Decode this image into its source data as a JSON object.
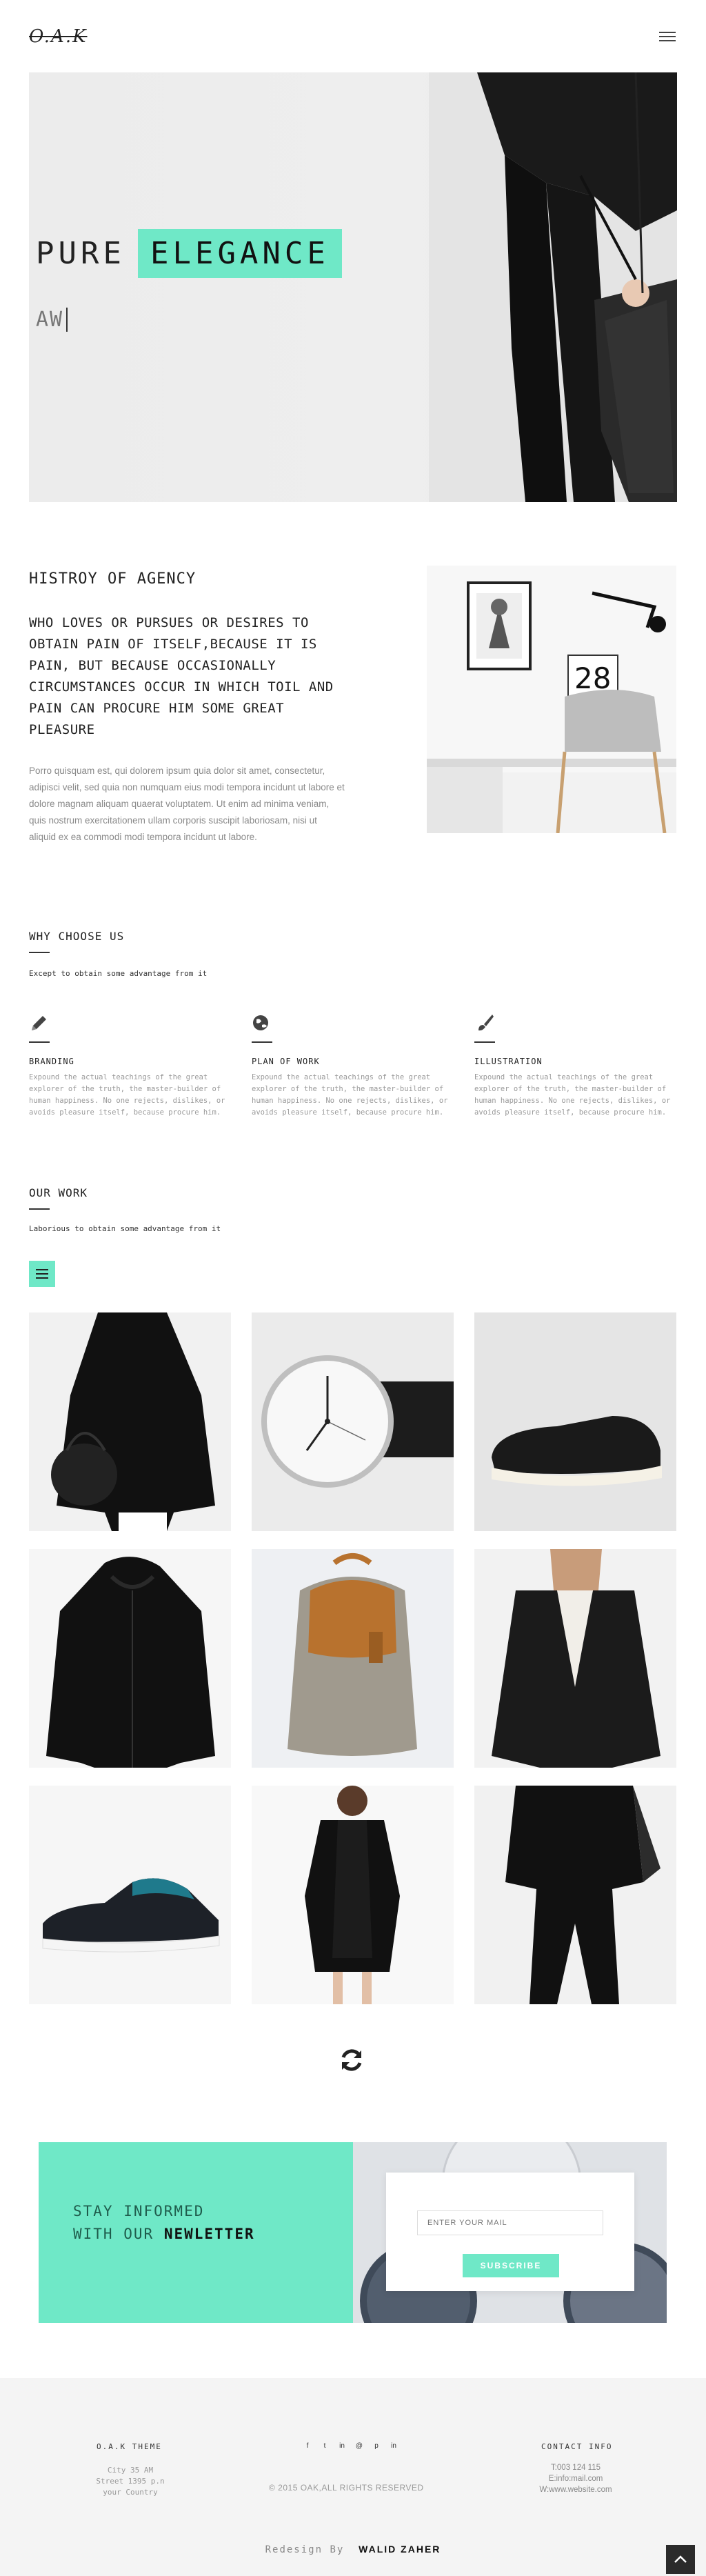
{
  "header": {
    "logo": "O.A.K",
    "menu_icon": "hamburger-menu-icon"
  },
  "hero": {
    "title_word1": "PURE",
    "title_word2": "ELEGANCE",
    "typed_text": "AW"
  },
  "history": {
    "title": "HISTROY OF AGENCY",
    "lead": "WHO LOVES OR PURSUES OR DESIRES TO OBTAIN PAIN OF ITSELF,BECAUSE IT IS PAIN, BUT BECAUSE OCCASIONALLY CIRCUMSTANCES OCCUR IN WHICH TOIL AND PAIN CAN PROCURE HIM SOME GREAT PLEASURE",
    "body": "Porro quisquam est, qui dolorem ipsum quia dolor sit amet, consectetur, adipisci velit, sed quia non numquam eius modi tempora incidunt ut labore et dolore magnam aliquam quaerat voluptatem. Ut enim ad minima veniam, quis nostrum exercitationem ullam corporis suscipit laboriosam, nisi ut aliquid ex ea commodi modi tempora incidunt ut labore.",
    "calendar_number": "28"
  },
  "why": {
    "title": "WHY CHOOSE US",
    "subtitle": "Except to obtain some advantage from it",
    "features": [
      {
        "icon": "pencil-icon",
        "title": "BRANDING",
        "text": "Expound the actual teachings of the great explorer of the truth, the master-builder of human happiness. No one rejects, dislikes, or avoids pleasure itself, because procure him."
      },
      {
        "icon": "globe-icon",
        "title": "PLAN OF WORK",
        "text": "Expound the actual teachings of the great explorer of the truth, the master-builder of human happiness. No one rejects, dislikes, or avoids pleasure itself, because procure him."
      },
      {
        "icon": "paintbrush-icon",
        "title": "ILLUSTRATION",
        "text": "Expound the actual teachings of the great explorer of the truth, the master-builder of human happiness. No one rejects, dislikes, or avoids pleasure itself, because procure him."
      }
    ]
  },
  "work": {
    "title": "OUR WORK",
    "subtitle": "Laborious to obtain some advantage from it",
    "filter_icon": "filter-menu-icon",
    "refresh_icon": "refresh-icon"
  },
  "newsletter": {
    "line1": "STAY INFORMED",
    "line2_prefix": "WITH OUR",
    "line2_bold": "NEWLETTER",
    "input_placeholder": "ENTER YOUR MAIL",
    "button": "SUBSCRIBE"
  },
  "footer": {
    "theme_title": "O.A.K THEME",
    "address_line1": "City 35 AM",
    "address_line2": "Street 1395 p.n",
    "address_line3": "your Country",
    "social": [
      "f",
      "t",
      "in",
      "@",
      "p",
      "in"
    ],
    "copyright": "© 2015 OAK,ALL RIGHTS RESERVED",
    "contact_title": "CONTACT INFO",
    "phone": "T:003 124 115",
    "email": "E:info:mail.com",
    "website": "W:www.website.com",
    "credit_prefix": "Redesign By",
    "credit_name": "WALID ZAHER"
  },
  "colors": {
    "accent": "#6fe8c7",
    "dark": "#222222",
    "muted": "#999999",
    "footer_bg": "#f4f4f4"
  }
}
